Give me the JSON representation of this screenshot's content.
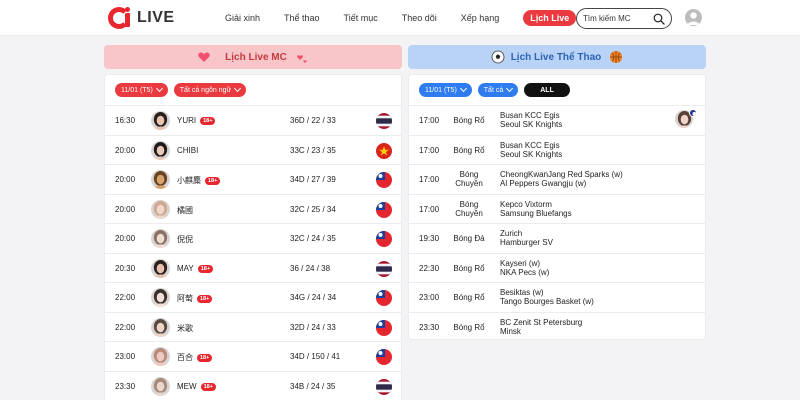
{
  "header": {
    "logo_text": "LIVE",
    "nav": [
      "Giải xinh",
      "Thể thao",
      "Tiết mục",
      "Theo dõi",
      "Xếp hạng",
      "Lịch Live"
    ],
    "search_placeholder": "Tìm kiếm MC"
  },
  "left": {
    "title": "Lịch Live MC",
    "filter_date": "11/01 (T5)",
    "filter_lang": "Tất cả ngôn ngữ",
    "badge": "18+",
    "rows": [
      {
        "time": "16:30",
        "name": "YURI",
        "badge": true,
        "meas": "36D / 22 / 33",
        "flag": "th",
        "skin": "#e7c3b0",
        "hair": "#2a1f1c"
      },
      {
        "time": "20:00",
        "name": "CHIBI",
        "badge": false,
        "meas": "33C / 23 / 35",
        "flag": "vn",
        "skin": "#e9c9b8",
        "hair": "#1d1a1a"
      },
      {
        "time": "20:00",
        "name": "小麒麋",
        "badge": true,
        "meas": "34D / 27 / 39",
        "flag": "tw",
        "skin": "#d8a36f",
        "hair": "#6a4522"
      },
      {
        "time": "20:00",
        "name": "橘國",
        "badge": false,
        "meas": "32C / 25 / 34",
        "flag": "tw",
        "skin": "#efd7cc",
        "hair": "#cfa98f"
      },
      {
        "time": "20:00",
        "name": "倪倪",
        "badge": false,
        "meas": "32C / 24 / 35",
        "flag": "tw",
        "skin": "#f1dcd3",
        "hair": "#8a7266"
      },
      {
        "time": "20:30",
        "name": "MAY",
        "badge": true,
        "meas": "36 / 24 / 38",
        "flag": "th",
        "skin": "#e6c1ad",
        "hair": "#2c2020"
      },
      {
        "time": "22:00",
        "name": "阿萄",
        "badge": true,
        "meas": "34G / 24 / 34",
        "flag": "tw",
        "skin": "#f0dfd8",
        "hair": "#3b302c"
      },
      {
        "time": "22:00",
        "name": "米歌",
        "badge": false,
        "meas": "32D / 24 / 33",
        "flag": "tw",
        "skin": "#eed5c8",
        "hair": "#5b4a42"
      },
      {
        "time": "23:00",
        "name": "百合",
        "badge": true,
        "meas": "34D / 150 / 41",
        "flag": "tw",
        "skin": "#edc9c0",
        "hair": "#b9897a"
      },
      {
        "time": "23:30",
        "name": "MEW",
        "badge": true,
        "meas": "34B / 24 / 35",
        "flag": "th",
        "skin": "#ead7cc",
        "hair": "#a58a7a"
      }
    ]
  },
  "right": {
    "title": "Lịch Live Thể Thao",
    "filter_date": "11/01 (T5)",
    "filter_all": "Tất cả",
    "filter_all_btn": "ALL",
    "rows": [
      {
        "time": "17:00",
        "sport": "Bóng Rổ",
        "team1": "Busan KCC Egis",
        "team2": "Seoul SK Knights",
        "mc": true
      },
      {
        "time": "17:00",
        "sport": "Bóng Rổ",
        "team1": "Busan KCC Egis",
        "team2": "Seoul SK Knights",
        "mc": false
      },
      {
        "time": "17:00",
        "sport": "Bóng Chuyền",
        "team1": "CheongKwanJang Red Sparks (w)",
        "team2": "Al Peppers Gwangju (w)",
        "mc": false
      },
      {
        "time": "17:00",
        "sport": "Bóng Chuyền",
        "team1": "Kepco Vixtorm",
        "team2": "Samsung Bluefangs",
        "mc": false
      },
      {
        "time": "19:30",
        "sport": "Bóng Đá",
        "team1": "Zurich",
        "team2": "Hamburger SV",
        "mc": false
      },
      {
        "time": "22:30",
        "sport": "Bóng Rổ",
        "team1": "Kayseri (w)",
        "team2": "NKA Pecs (w)",
        "mc": false
      },
      {
        "time": "23:00",
        "sport": "Bóng Rổ",
        "team1": "Besiktas (w)",
        "team2": "Tango Bourges Basket (w)",
        "mc": false
      },
      {
        "time": "23:30",
        "sport": "Bóng Rổ",
        "team1": "BC Zenit St Petersburg",
        "team2": "Minsk",
        "mc": false
      }
    ]
  }
}
